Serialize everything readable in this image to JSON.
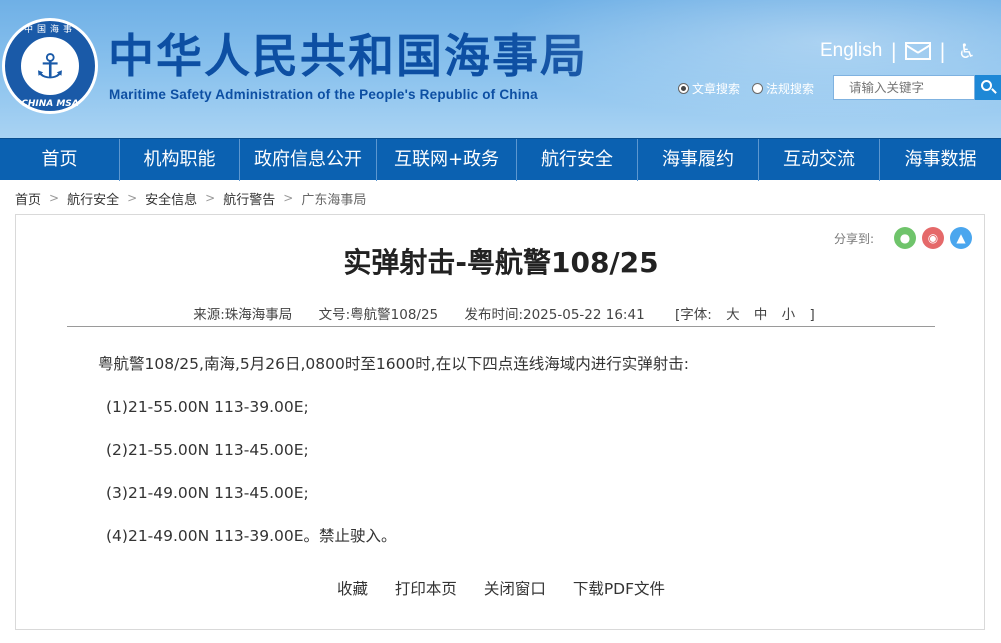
{
  "header": {
    "logo": {
      "ring_top": "中国海事",
      "ring_bottom": "CHINA MSA",
      "icon": "anchor-icon"
    },
    "title": "中华人民共和国海事局",
    "subtitle": "Maritime Safety Administration of the People's Republic of China",
    "english_link": "English",
    "separator": "|",
    "mail_icon": "mail-icon",
    "accessibility_icon": "wheelchair-icon",
    "search": {
      "option_articles": "文章搜索",
      "option_regulations": "法规搜索",
      "selected": "文章搜索",
      "placeholder": "请输入关键字",
      "button_icon": "search-icon"
    }
  },
  "nav": {
    "items": [
      {
        "label": "首页"
      },
      {
        "label": "机构职能"
      },
      {
        "label": "政府信息公开"
      },
      {
        "label": "互联网+政务"
      },
      {
        "label": "航行安全"
      },
      {
        "label": "海事履约"
      },
      {
        "label": "互动交流"
      },
      {
        "label": "海事数据"
      }
    ]
  },
  "breadcrumb": {
    "items": [
      "首页",
      "航行安全",
      "安全信息",
      "航行警告"
    ],
    "current": "广东海事局",
    "separator": ">"
  },
  "article": {
    "share_label": "分享到:",
    "share_icons": [
      "wechat-icon",
      "weibo-icon",
      "qq-icon"
    ],
    "title": "实弹射击-粤航警108/25",
    "meta": {
      "source": "来源:珠海海事局",
      "doc_no": "文号:粤航警108/25",
      "published": "发布时间:2025-05-22 16:41",
      "font_label": "[字体:",
      "font_large": "大",
      "font_medium": "中",
      "font_small": "小",
      "font_close": "]"
    },
    "paragraphs": [
      "粤航警108/25,南海,5月26日,0800时至1600时,在以下四点连线海域内进行实弹射击:",
      "(1)21-55.00N 113-39.00E;",
      "(2)21-55.00N 113-45.00E;",
      "(3)21-49.00N 113-45.00E;",
      "(4)21-49.00N 113-39.00E。禁止驶入。"
    ],
    "actions": {
      "favorite": "收藏",
      "print": "打印本页",
      "close": "关闭窗口",
      "download_pdf": "下载PDF文件"
    }
  },
  "colors": {
    "nav_bg": "#0b61b1",
    "title_blue": "#0d4fa3",
    "header_sky": "#8cc3ee"
  }
}
